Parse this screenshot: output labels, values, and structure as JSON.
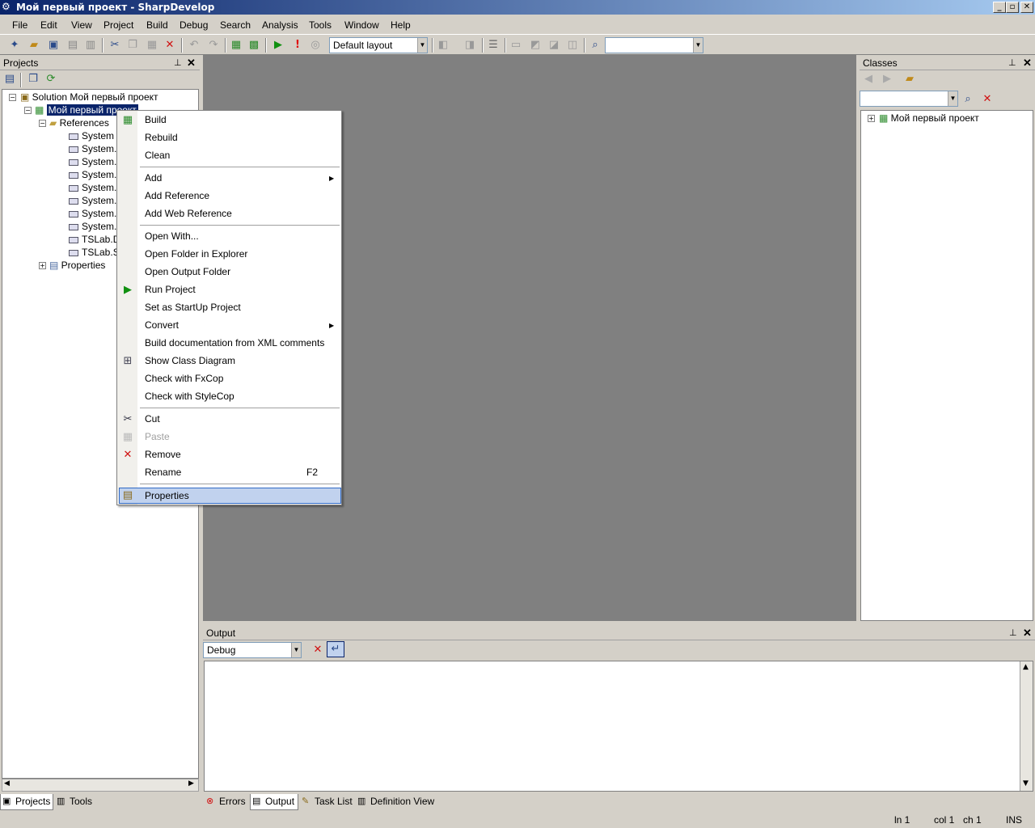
{
  "window": {
    "title": "Мой первый проект - SharpDevelop",
    "app_icon": "sharpdevelop-icon",
    "buttons": [
      "_",
      "▫",
      "✕"
    ]
  },
  "menu": [
    "File",
    "Edit",
    "View",
    "Project",
    "Build",
    "Debug",
    "Search",
    "Analysis",
    "Tools",
    "Window",
    "Help"
  ],
  "toolbar": {
    "layout_combo": "Default layout",
    "search_combo": ""
  },
  "projects_panel": {
    "title": "Projects",
    "pin": "⊥",
    "close": "✕",
    "tree": {
      "solution": "Solution Мой первый проект",
      "project": "Мой первый проект",
      "references_label": "References",
      "references": [
        "System",
        "System.C",
        "System.D",
        "System.D",
        "System.D",
        "System.V",
        "System.X",
        "System.X",
        "TSLab.D",
        "TSLab.S"
      ],
      "properties_label": "Properties"
    },
    "tabs": [
      "Projects",
      "Tools"
    ]
  },
  "context_menu": {
    "items": {
      "build": "Build",
      "rebuild": "Rebuild",
      "clean": "Clean",
      "add": "Add",
      "add_reference": "Add Reference",
      "add_web_reference": "Add Web Reference",
      "open_with": "Open With...",
      "open_folder": "Open Folder in Explorer",
      "open_output": "Open Output Folder",
      "run_project": "Run Project",
      "set_startup": "Set as StartUp Project",
      "convert": "Convert",
      "build_docs": "Build documentation from XML comments",
      "show_class_diagram": "Show Class Diagram",
      "check_fxcop": "Check with FxCop",
      "check_stylecop": "Check with StyleCop",
      "cut": "Cut",
      "paste": "Paste",
      "remove": "Remove",
      "rename": "Rename",
      "rename_shortcut": "F2",
      "properties": "Properties"
    },
    "highlight_color": "#c1d2ee"
  },
  "classes_panel": {
    "title": "Classes",
    "pin": "⊥",
    "close": "✕",
    "tree_root": "Мой первый проект"
  },
  "output_panel": {
    "title": "Output",
    "pin": "⊥",
    "close": "✕",
    "category": "Debug",
    "tabs": [
      "Errors",
      "Output",
      "Task List",
      "Definition View"
    ]
  },
  "statusbar": {
    "line": "ln 1",
    "col": "col 1",
    "ch": "ch 1",
    "mode": "INS"
  },
  "colors": {
    "titlebar_start": "#0a246a",
    "titlebar_end": "#a6caf0",
    "workspace": "#808080",
    "chrome": "#d4d0c8"
  }
}
